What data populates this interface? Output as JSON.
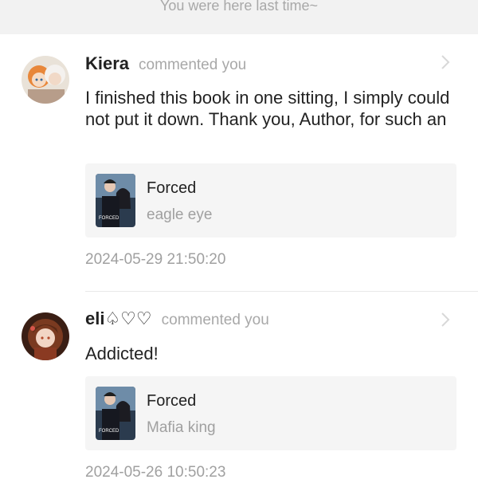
{
  "banner": {
    "text": "You were here last time~"
  },
  "notifications": [
    {
      "username": "Kiera",
      "action": "commented you",
      "comment": "I finished this book in one sitting, I simply could not put it down. Thank you, Author, for such an",
      "book": {
        "title": "Forced",
        "subtitle": "eagle eye",
        "cover_text": "FORCED"
      },
      "timestamp": "2024-05-29 21:50:20",
      "avatar_icon": "anime-avatar-icon",
      "chevron_icon": "chevron-right-icon"
    },
    {
      "username": "eli♤♡♡",
      "action": "commented you",
      "comment": "Addicted!",
      "book": {
        "title": "Forced",
        "subtitle": "Mafia king",
        "cover_text": "FORCED"
      },
      "timestamp": "2024-05-26 10:50:23",
      "avatar_icon": "anime-avatar-icon",
      "chevron_icon": "chevron-right-icon"
    }
  ],
  "colors": {
    "banner_bg": "#f2f2f2",
    "card_bg": "#f5f5f5",
    "muted_text": "#a0a0a0",
    "primary_text": "#222222"
  }
}
